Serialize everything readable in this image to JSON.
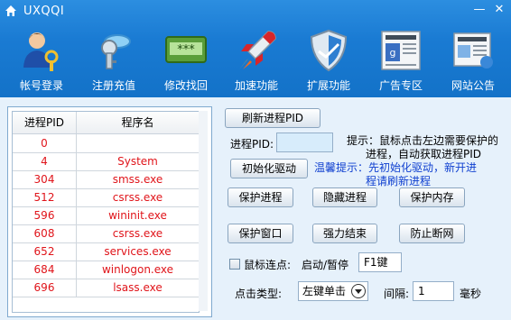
{
  "window": {
    "title": "UXQQI",
    "minimize": "—",
    "close": "✕"
  },
  "toolbar": [
    {
      "label": "帐号登录",
      "icon": "user-key-icon"
    },
    {
      "label": "注册充值",
      "icon": "key-icon"
    },
    {
      "label": "修改找回",
      "icon": "password-card-icon"
    },
    {
      "label": "加速功能",
      "icon": "rocket-icon"
    },
    {
      "label": "扩展功能",
      "icon": "shield-icon"
    },
    {
      "label": "广告专区",
      "icon": "newspaper-icon"
    },
    {
      "label": "网站公告",
      "icon": "web-news-icon"
    }
  ],
  "process_list": {
    "headers": {
      "pid": "进程PID",
      "name": "程序名"
    },
    "rows": [
      {
        "pid": "0",
        "name": ""
      },
      {
        "pid": "4",
        "name": "System"
      },
      {
        "pid": "304",
        "name": "smss.exe"
      },
      {
        "pid": "512",
        "name": "csrss.exe"
      },
      {
        "pid": "596",
        "name": "wininit.exe"
      },
      {
        "pid": "608",
        "name": "csrss.exe"
      },
      {
        "pid": "652",
        "name": "services.exe"
      },
      {
        "pid": "684",
        "name": "winlogon.exe"
      },
      {
        "pid": "696",
        "name": "lsass.exe"
      }
    ]
  },
  "controls": {
    "refresh": "刷新进程PID",
    "pid_label": "进程PID:",
    "pid_value": "",
    "hint1_line1": "提示：鼠标点击左边需要保护的",
    "hint1_line2": "进程，自动获取进程PID",
    "init_driver": "初始化驱动",
    "hint2_line1": "温馨提示：先初始化驱动，新开进",
    "hint2_line2": "程请刷新进程",
    "protect_process": "保护进程",
    "hide_process": "隐藏进程",
    "protect_memory": "保护内存",
    "protect_window": "保护窗口",
    "force_end": "强力结束",
    "prevent_disconnect": "防止断网",
    "mouse_click_label": "鼠标连点:",
    "start_stop_label": "启动/暂停",
    "hotkey_value": "F1键",
    "click_type_label": "点击类型:",
    "click_type_value": "左键单击",
    "interval_label": "间隔:",
    "interval_value": "1",
    "interval_unit": "毫秒"
  },
  "colors": {
    "banner": "#1a7bd3",
    "pid_text": "#e0141a",
    "hint_blue": "#1040d0"
  }
}
